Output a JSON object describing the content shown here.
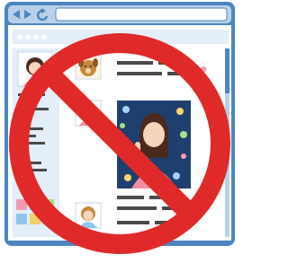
{
  "illustration": {
    "subject": "social-media-feed-in-browser",
    "overlay": "prohibition-sign",
    "colors": {
      "window_frame": "#4b86c0",
      "titlebar": "#b9d0e8",
      "titlebar_icons": "#4b86c0",
      "page_background": "#ffffff",
      "sidebar_background": "#e4eef8",
      "text_placeholder": "#4a4a4a",
      "prohibition_red": "#e02a2a",
      "photo_frame": "#1f3f6e",
      "avatar_hair": "#4a2a1f",
      "avatar_skin": "#f7d5bc",
      "avatar_shirt_pink": "#ef8e9f",
      "dog_fur": "#c8893a",
      "heart_pink": "#f29bb0"
    },
    "icons": [
      "back-arrow-icon",
      "forward-arrow-icon",
      "reload-icon",
      "heart-icon"
    ]
  }
}
